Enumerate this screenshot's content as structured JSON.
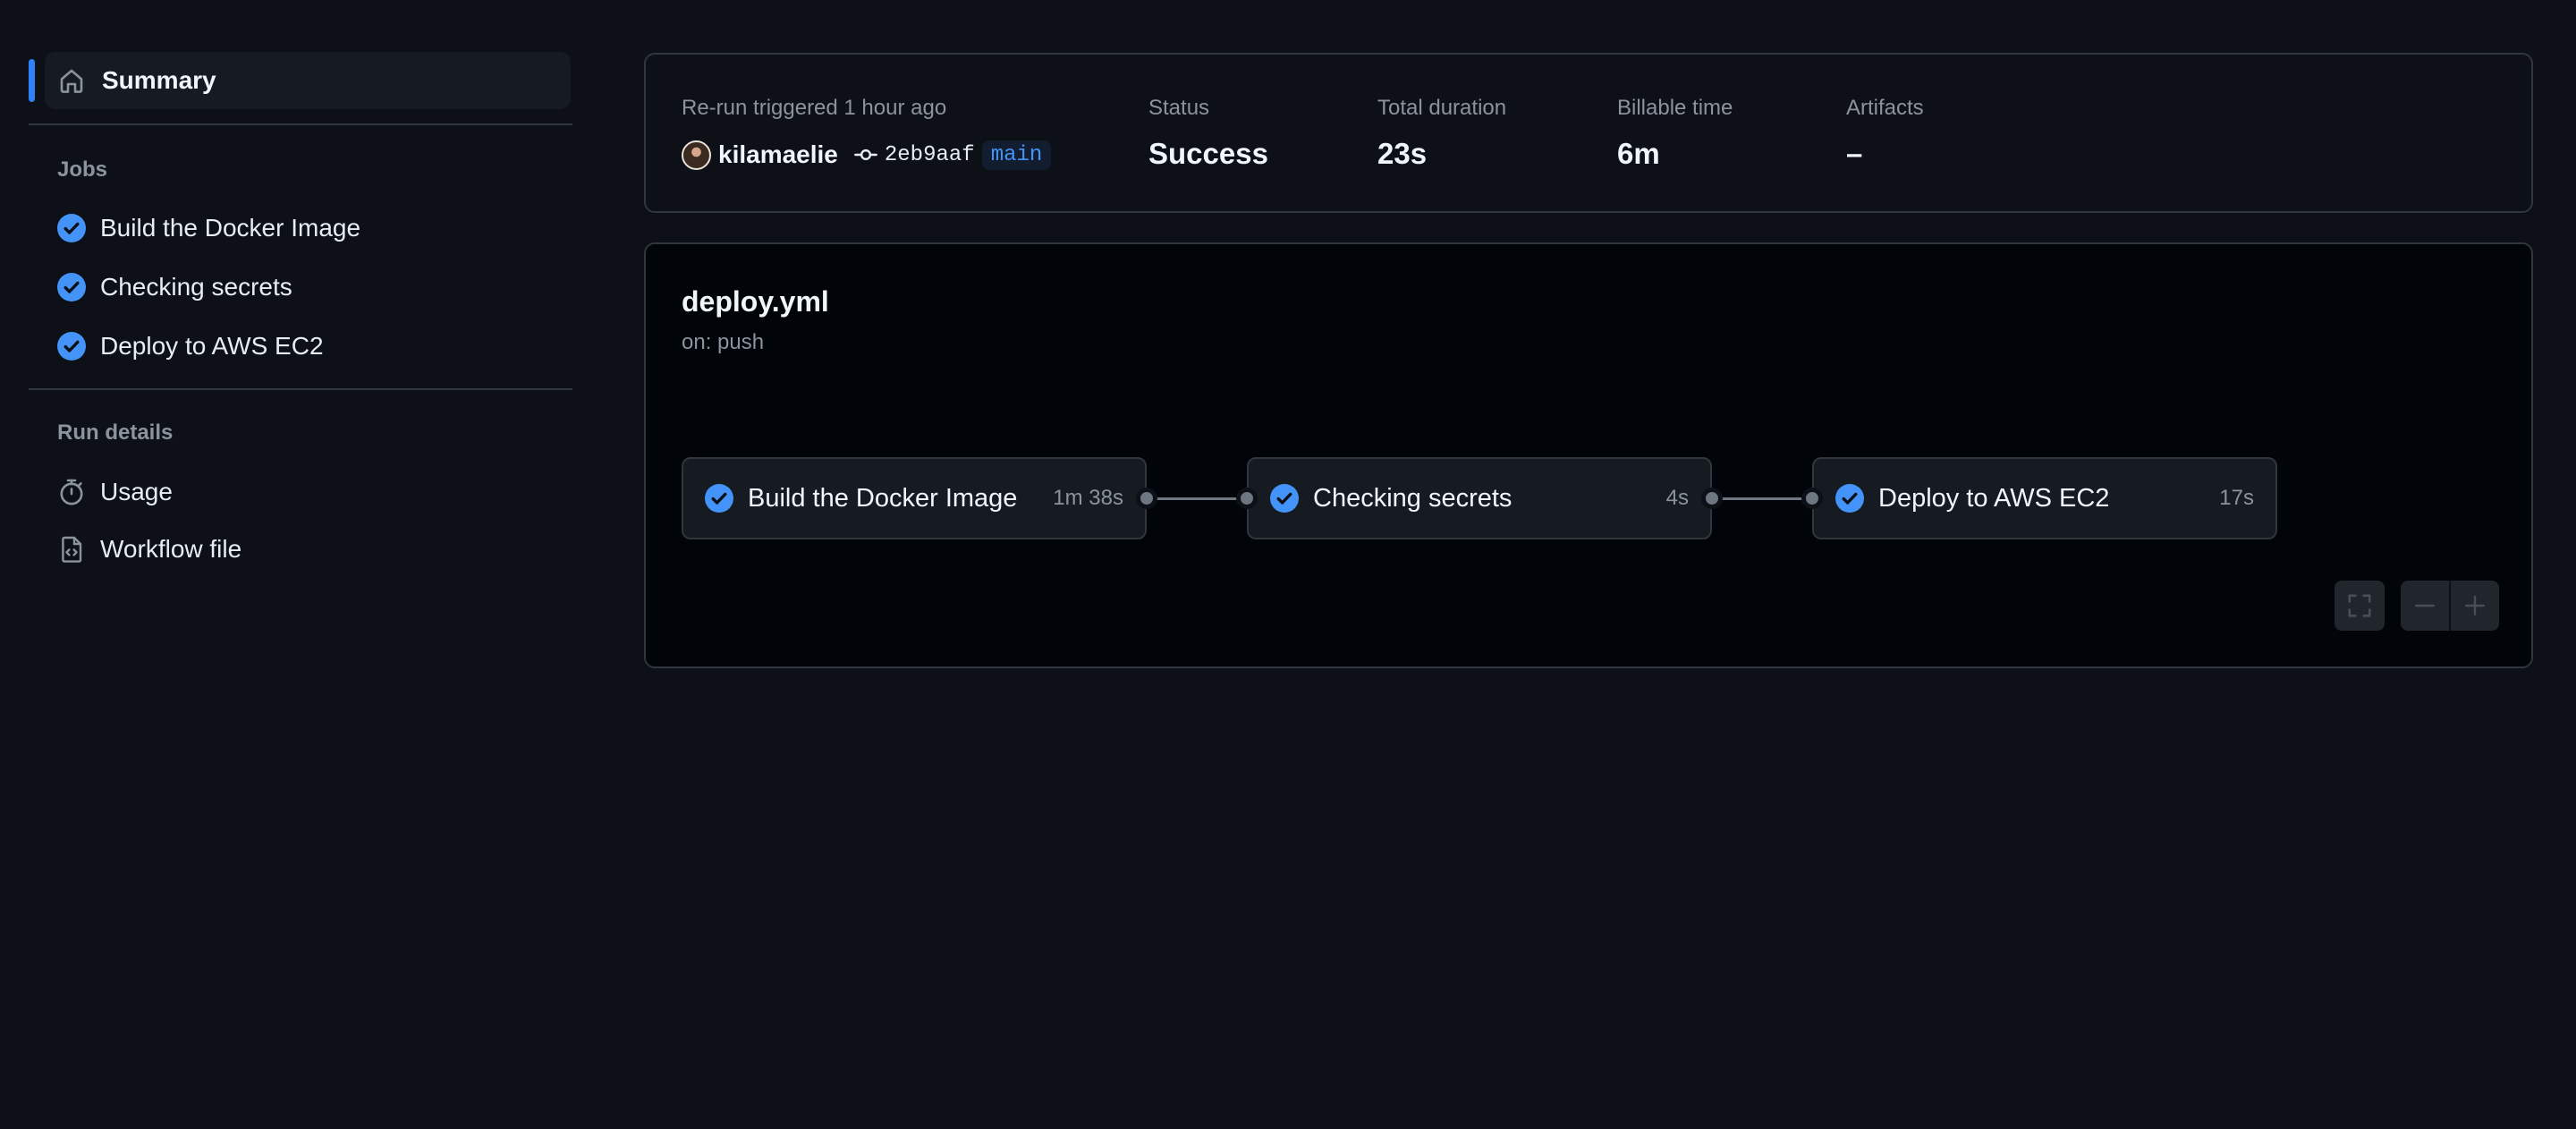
{
  "sidebar": {
    "summary_label": "Summary",
    "jobs_title": "Jobs",
    "jobs": [
      {
        "label": "Build the Docker Image",
        "status": "success"
      },
      {
        "label": "Checking secrets",
        "status": "success"
      },
      {
        "label": "Deploy to AWS EC2",
        "status": "success"
      }
    ],
    "run_details_title": "Run details",
    "run_details": [
      {
        "label": "Usage",
        "icon": "stopwatch-icon"
      },
      {
        "label": "Workflow file",
        "icon": "file-code-icon"
      }
    ]
  },
  "summary": {
    "trigger_text": "Re-run triggered 1 hour ago",
    "actor": "kilamaelie",
    "commit_sha": "2eb9aaf",
    "branch": "main",
    "status_label": "Status",
    "status_value": "Success",
    "duration_label": "Total duration",
    "duration_value": "23s",
    "billable_label": "Billable time",
    "billable_value": "6m",
    "artifacts_label": "Artifacts",
    "artifacts_value": "–"
  },
  "workflow": {
    "file_name": "deploy.yml",
    "trigger": "on: push",
    "jobs": [
      {
        "name": "Build the Docker Image",
        "duration": "1m 38s",
        "status": "success"
      },
      {
        "name": "Checking secrets",
        "duration": "4s",
        "status": "success"
      },
      {
        "name": "Deploy to AWS EC2",
        "duration": "17s",
        "status": "success"
      }
    ]
  },
  "colors": {
    "background": "#0d1117",
    "accent": "#2f81f7",
    "success_icon": "#4493f8",
    "border": "#30363d",
    "muted_text": "#8b949e"
  }
}
